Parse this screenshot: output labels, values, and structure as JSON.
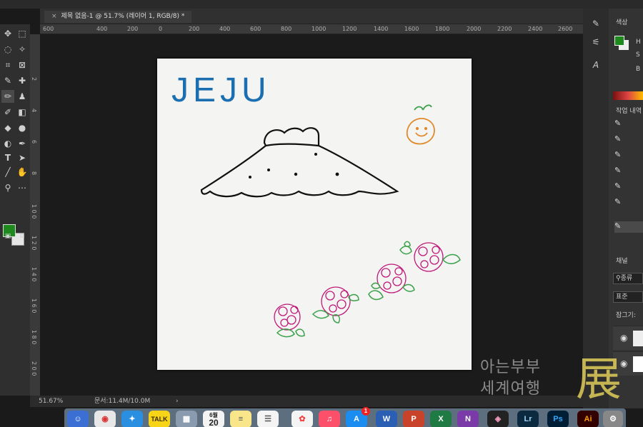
{
  "document_tab": {
    "title": "제목 없음-1 @ 51.7% (레이어 1, RGB/8) *",
    "close_glyph": "×"
  },
  "ruler_h_ticks": [
    "600",
    "400",
    "200",
    "0",
    "200",
    "400",
    "600",
    "800",
    "1000",
    "1200",
    "1400",
    "1600",
    "1800",
    "2000",
    "2200",
    "2400",
    "2600"
  ],
  "ruler_v_ticks": [
    "0",
    "2",
    "4",
    "6",
    "8",
    "1 0 0",
    "1 2 0",
    "1 4 0",
    "1 6 0",
    "1 8 0",
    "2 0 0"
  ],
  "status": {
    "zoom": "51.67%",
    "doc_size": "문서:11.4M/10.0M",
    "arrow": "›"
  },
  "canvas": {
    "title_text": "JEJU",
    "title_color": "#1b6fb0",
    "mountain_color": "#111111",
    "tangerine_color": "#e08a2e",
    "leaf_color": "#3aa14a",
    "flower_color": "#c0187a"
  },
  "right_panel": {
    "color_label": "색상",
    "color_channel_letters": [
      "H",
      "S",
      "B"
    ],
    "history_label": "작업 내역",
    "channels_label": "채널",
    "search_label": "종류",
    "mode_label": "표준",
    "lock_label": "잠그기:"
  },
  "colors": {
    "foreground": "#1e8a1e",
    "background": "#e6e6e6"
  },
  "dock": {
    "calendar_month": "6월",
    "calendar_day": "20",
    "appstore_badge": "1",
    "kakao_label": "TALK",
    "word_label": "W",
    "powerpoint_label": "P",
    "excel_label": "X",
    "onenote_label": "N",
    "lightroom_label": "Lr",
    "photoshop_label": "Ps",
    "illustrator_label": "Ai"
  },
  "watermark": {
    "line1": "아는부부",
    "line2": "세계여행",
    "big_char": "展"
  }
}
